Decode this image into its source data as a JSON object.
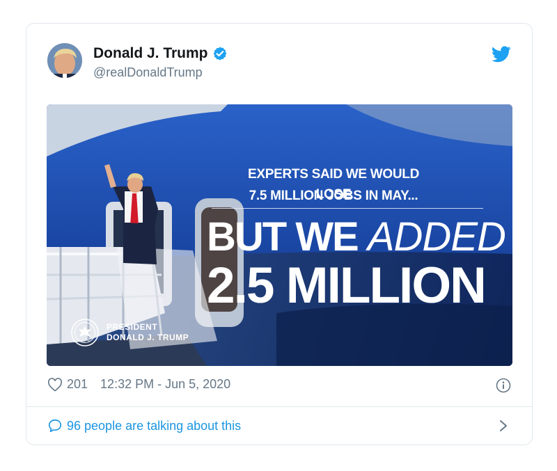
{
  "tweet": {
    "display_name": "Donald J. Trump",
    "handle": "@realDonaldTrump",
    "likes": "201",
    "timestamp": "12:32 PM - Jun 5, 2020",
    "talking": "96 people are talking about this"
  },
  "media": {
    "line1": "EXPERTS SAID WE WOULD LOSE",
    "line2": "7.5 MILLION JOBS IN MAY...",
    "headline_a": "BUT WE ",
    "headline_b": "ADDED",
    "headline_c": "2.5 MILLION",
    "caption_1": "PRESIDENT",
    "caption_2": "DONALD J. TRUMP"
  },
  "colors": {
    "accent": "#1da1f2",
    "link": "#1b95e0",
    "muted": "#657786",
    "border": "#e1e8ed",
    "plane_blue": "#1c46a8"
  },
  "icons": [
    "verified-badge-icon",
    "twitter-bird-icon",
    "heart-icon",
    "info-icon",
    "speech-bubble-icon",
    "chevron-right-icon"
  ]
}
